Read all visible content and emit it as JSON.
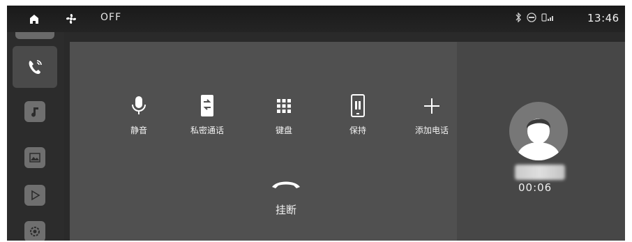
{
  "status_bar": {
    "home_icon": "home-icon",
    "fan_icon": "fan-icon",
    "ac_status": "OFF",
    "indicators": [
      "bluetooth-icon",
      "connected-icon",
      "signal-icon"
    ],
    "time": "13:46"
  },
  "dock": {
    "items": [
      {
        "name": "phone",
        "icon": "phone-icon",
        "active": true
      },
      {
        "name": "music",
        "icon": "music-note-icon",
        "active": false
      },
      {
        "name": "gallery",
        "icon": "image-icon",
        "active": false
      },
      {
        "name": "video",
        "icon": "play-icon",
        "active": false
      },
      {
        "name": "settings",
        "icon": "settings-icon",
        "active": false
      }
    ]
  },
  "call": {
    "actions": [
      {
        "label": "静音",
        "icon": "microphone-icon"
      },
      {
        "label": "私密通话",
        "icon": "private-call-icon"
      },
      {
        "label": "键盘",
        "icon": "keypad-icon"
      },
      {
        "label": "保持",
        "icon": "hold-icon"
      },
      {
        "label": "添加电话",
        "icon": "add-call-icon"
      }
    ],
    "hangup_label": "挂断",
    "duration": "00:06",
    "colors": {
      "panel": "#505050",
      "background": "#2a2a2a",
      "text": "#f2f2f2"
    }
  }
}
